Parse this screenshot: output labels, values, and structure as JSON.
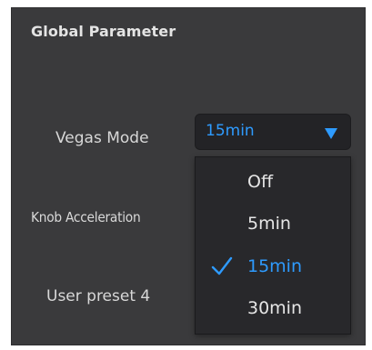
{
  "panel": {
    "title": "Global Parameter"
  },
  "params": {
    "vegas_mode": {
      "label": "Vegas Mode",
      "value": "15min"
    },
    "knob_acceleration": {
      "label": "Knob Acceleration"
    },
    "user_preset": {
      "label": "User preset 4"
    }
  },
  "dropdown": {
    "options": [
      "Off",
      "5min",
      "15min",
      "30min"
    ],
    "selected": "15min"
  },
  "colors": {
    "accent": "#2e9bff",
    "panel_bg": "#3a3a3c",
    "menu_bg": "#28282b"
  },
  "icons": {
    "caret": "caret-down-icon",
    "check": "checkmark-icon"
  }
}
